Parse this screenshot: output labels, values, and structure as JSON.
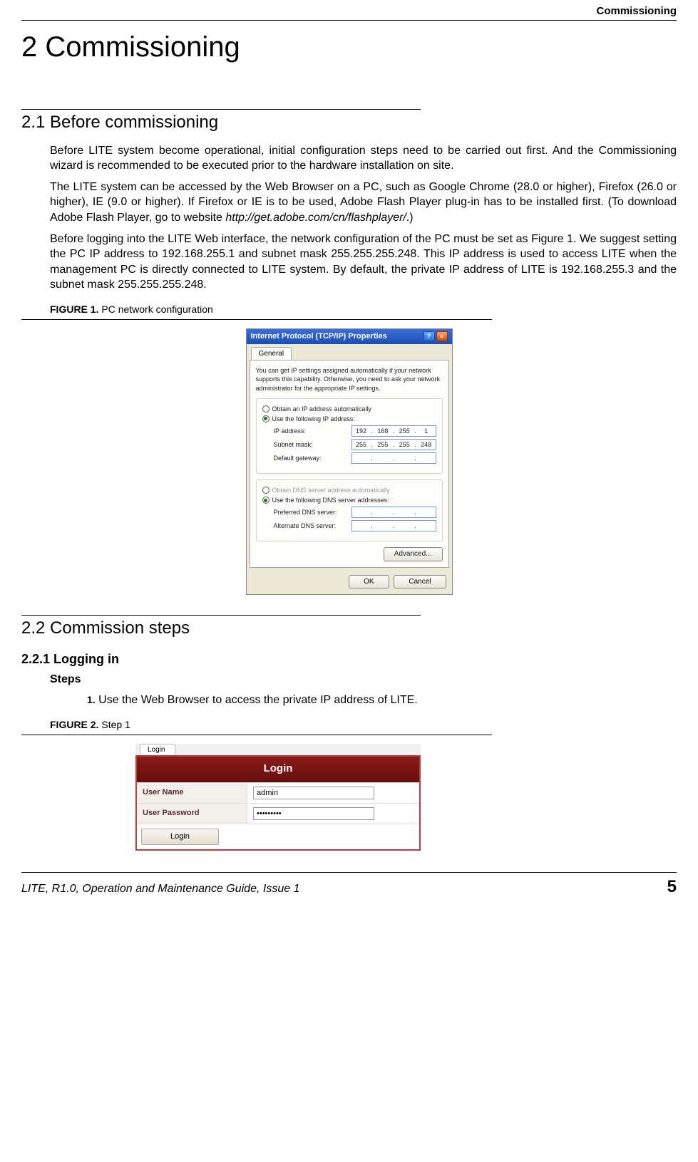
{
  "header": {
    "running": "Commissioning"
  },
  "chapter": {
    "title": "2 Commissioning"
  },
  "s21": {
    "title": "2.1 Before commissioning",
    "p1": "Before LITE system become operational, initial configuration steps need to be carried out first. And the Commissioning wizard is recommended to be executed prior to the hardware installation on site.",
    "p2a": "The LITE system can be accessed by the Web Browser on a PC, such as Google Chrome (28.0 or higher), Firefox (26.0 or higher), IE (9.0 or higher). If Firefox or IE is to be used, Adobe Flash Player plug-in has to be installed first. (To download Adobe Flash Player, go to website ",
    "p2url": "http://get.adobe.com/cn/flashplayer/",
    "p2b": ".)",
    "p3": "Before logging into the LITE Web interface, the network configuration of the PC must be set as Figure 1. We suggest setting the PC IP address to 192.168.255.1 and subnet mask 255.255.255.248. This IP address is used to access LITE when the management PC is directly connected to LITE system. By default, the private IP address of LITE is 192.168.255.3 and the subnet mask 255.255.255.248."
  },
  "fig1": {
    "cap_bold": "FIGURE 1. ",
    "cap_rest": "PC network configuration",
    "dlg_title": "Internet Protocol (TCP/IP) Properties",
    "help_btn": "?",
    "close_btn": "×",
    "tab": "General",
    "desc": "You can get IP settings assigned automatically if your network supports this capability. Otherwise, you need to ask your network administrator for the appropriate IP settings.",
    "r_auto_ip": "Obtain an IP address automatically",
    "r_use_ip": "Use the following IP address:",
    "lbl_ip": "IP address:",
    "lbl_mask": "Subnet mask:",
    "lbl_gw": "Default gateway:",
    "ip": [
      "192",
      "168",
      "255",
      "1"
    ],
    "mask": [
      "255",
      "255",
      "255",
      "248"
    ],
    "r_auto_dns": "Obtain DNS server address automatically",
    "r_use_dns": "Use the following DNS server addresses:",
    "lbl_pdns": "Preferred DNS server:",
    "lbl_adns": "Alternate DNS server:",
    "btn_adv": "Advanced...",
    "btn_ok": "OK",
    "btn_cancel": "Cancel"
  },
  "s22": {
    "title": "2.2 Commission steps",
    "s221": "2.2.1 Logging in",
    "steps_h": "Steps",
    "step1_num": "1.",
    "step1_txt": " Use the Web Browser to access the private IP address of LITE."
  },
  "fig2": {
    "cap_bold": "FIGURE 2. ",
    "cap_rest": "Step 1",
    "tab": "Login",
    "head": "Login",
    "lbl_user": "User Name",
    "val_user": "admin",
    "lbl_pass": "User Password",
    "val_pass": "•••••••••",
    "btn": "Login"
  },
  "footer": {
    "left": "LITE, R1.0, Operation and Maintenance Guide, Issue 1",
    "right": "5"
  }
}
